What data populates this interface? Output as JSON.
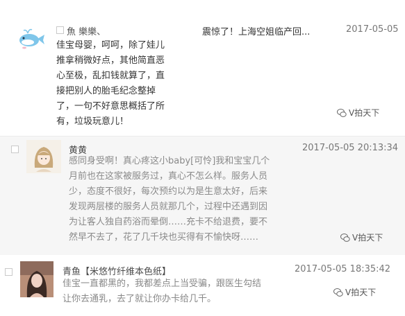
{
  "comments": [
    {
      "name": "魚 樂樂、",
      "time": "2017-05-05",
      "post_title": "震惊了！上海空姐临产回...",
      "lines": [
        "佳宝母婴，呵呵，除了娃儿",
        "推拿稍微好点，其他简直恶",
        "心至极，乱扣钱就算了，直",
        "接把别人的胎毛纪念整掉",
        "了，一句不好意思概括了所",
        "有，垃圾玩意儿！"
      ],
      "watermark": "V拍天下"
    },
    {
      "name": "黄黄",
      "time": "2017-05-05 20:13:34",
      "lines": [
        "感同身受啊！真心疼这小baby[可怜]我和宝宝几个",
        "月前也在这家被服务过，真心不怎么样。服务人员",
        "少，态度不很好，每次预约以为是生意太好，后来",
        "发现两层楼的服务人员就那几个，过程中还遇到因",
        "为让客人独自药浴而晕倒……充卡不给退费，要不",
        "然早不去了，花了几千块也买得有不愉快呀……"
      ],
      "watermark": "V拍天下"
    },
    {
      "name": "青鱼【米悠竹纤维本色纸】",
      "time": "2017-05-05 18:35:42",
      "lines": [
        "佳宝一直都黑的，我都差点上当受骗，跟医生勾结",
        "让你去通乳，去了就让你办卡给几千。"
      ],
      "watermark": "V拍天下"
    }
  ],
  "icons": {
    "watermark_icon": "wechat-icon",
    "avatar1": "whale-avatar",
    "avatar2": "cartoon-girl-avatar",
    "avatar3": "photo-avatar"
  }
}
